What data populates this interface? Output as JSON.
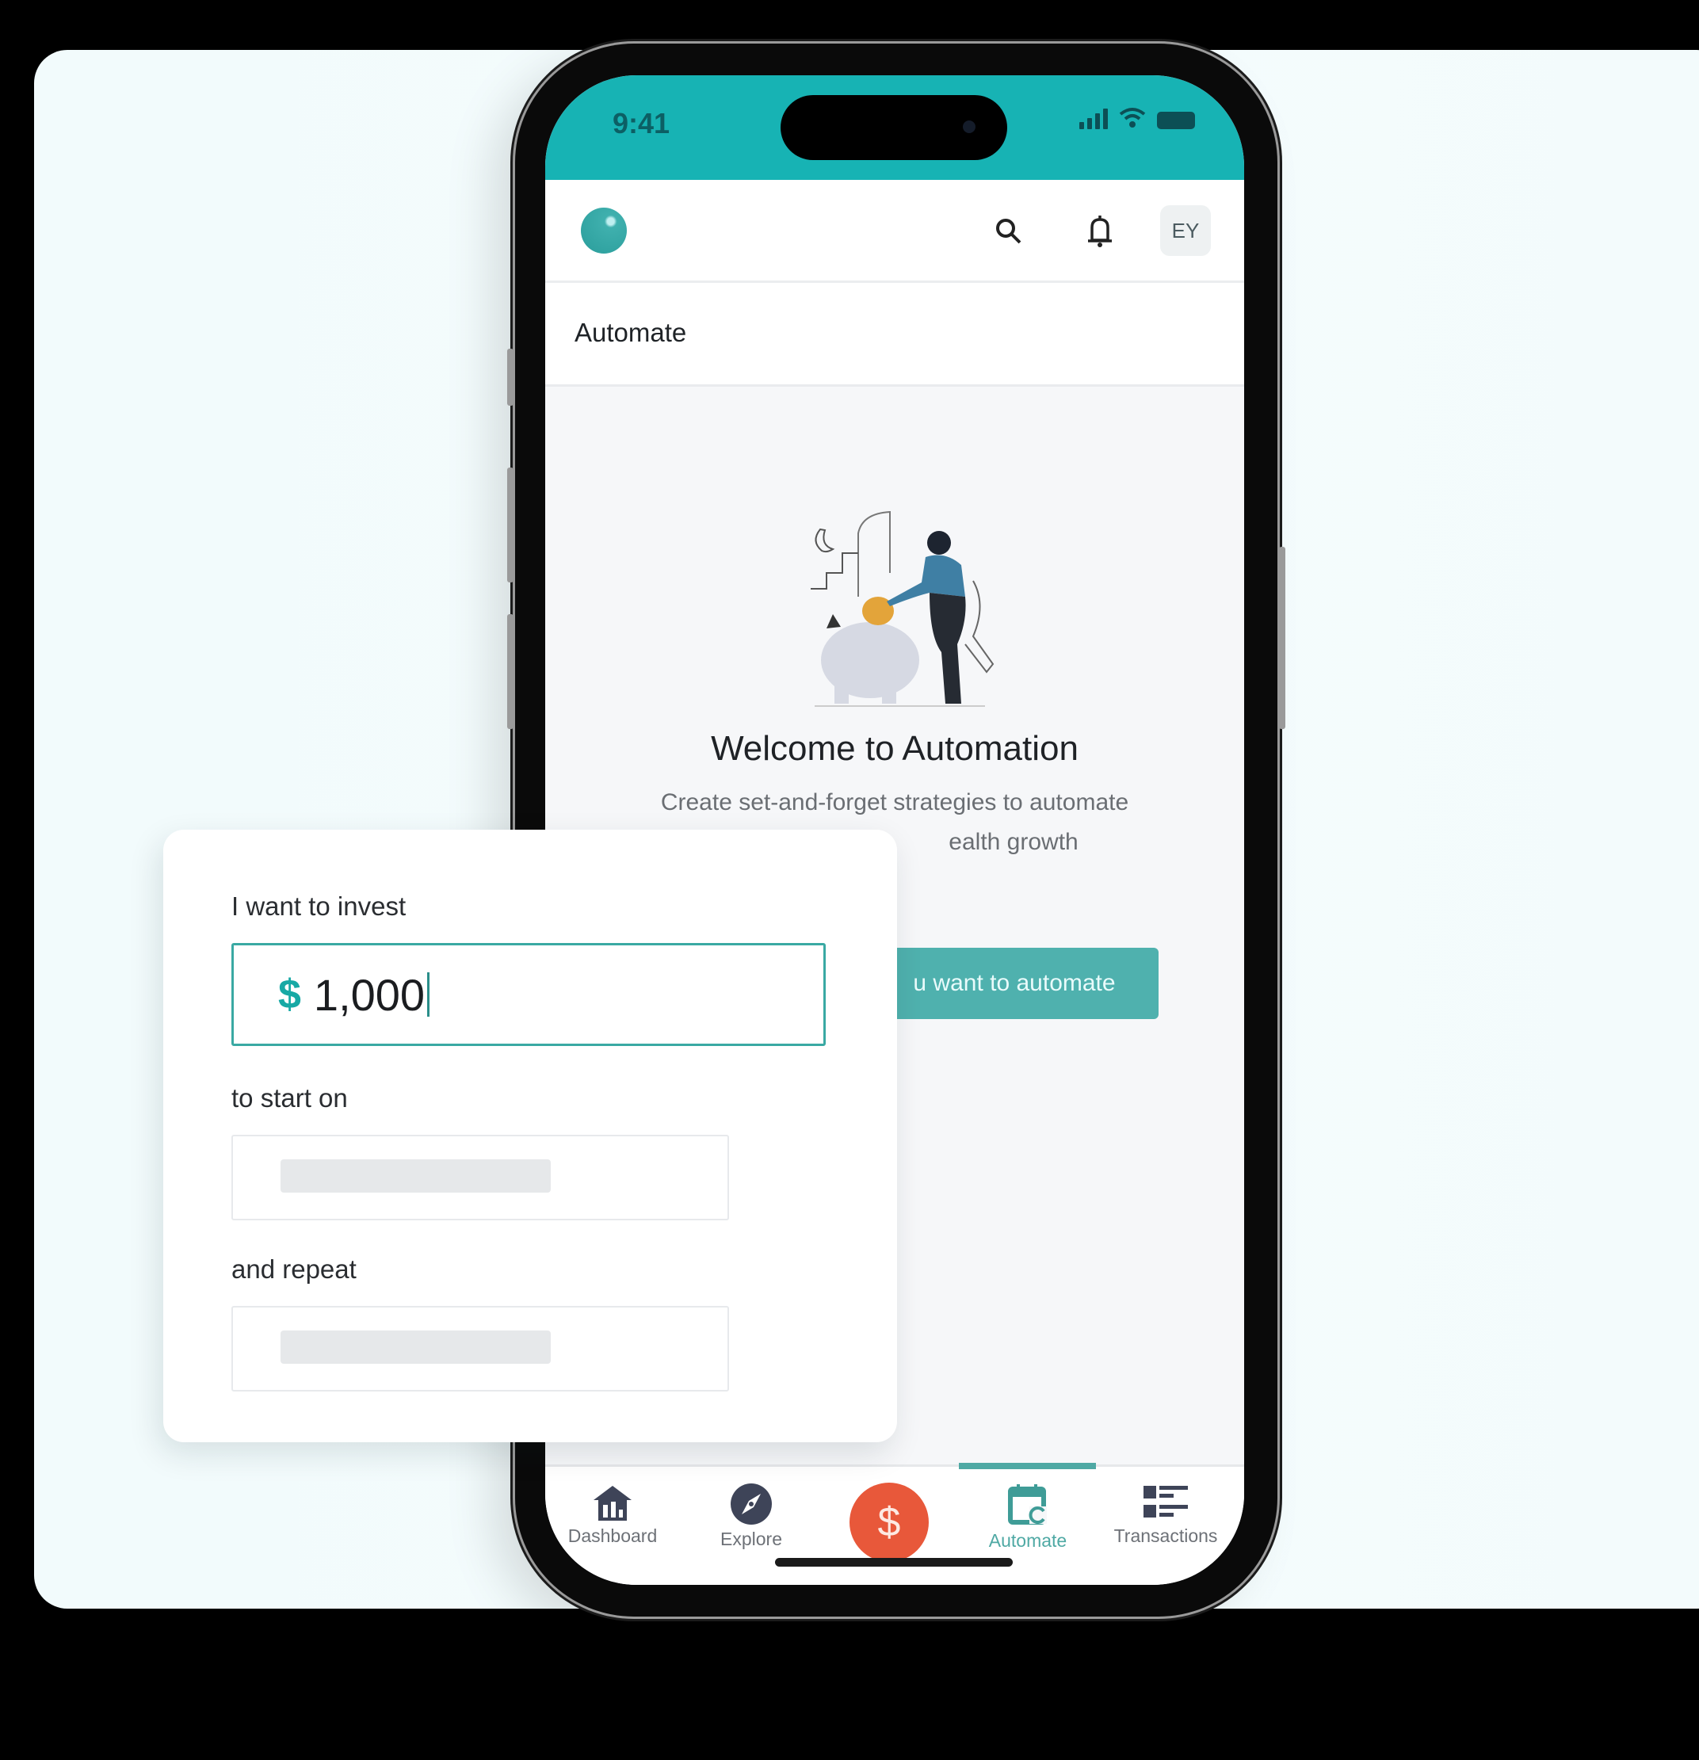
{
  "status_bar": {
    "time": "9:41",
    "icons": [
      "signal-icon",
      "wifi-icon",
      "battery-icon"
    ]
  },
  "header": {
    "logo": "app-logo",
    "search_icon": "search-icon",
    "bell_icon": "bell-icon",
    "avatar_initials": "EY"
  },
  "page": {
    "title": "Automate"
  },
  "welcome": {
    "illustration": "piggy-bank-illustration",
    "title": "Welcome to Automation",
    "subtitle_line1": "Create set-and-forget strategies to automate",
    "subtitle_line2_visible": "ealth growth",
    "cta_visible": "u want to automate"
  },
  "bottom_nav": {
    "items": [
      {
        "label": "Dashboard",
        "icon": "home-chart-icon",
        "active": false
      },
      {
        "label": "Explore",
        "icon": "compass-icon",
        "active": false
      },
      {
        "label": "",
        "icon": "dollar-icon",
        "active": false
      },
      {
        "label": "Automate",
        "icon": "calendar-repeat-icon",
        "active": true
      },
      {
        "label": "Transactions",
        "icon": "list-icon",
        "active": false
      }
    ],
    "fab_symbol": "$"
  },
  "form": {
    "invest_label": "I want to invest",
    "currency_symbol": "$",
    "amount_value": "1,000",
    "start_label": "to start on",
    "repeat_label": "and repeat"
  },
  "colors": {
    "teal": "#17b3b4",
    "accent": "#4fb1ae",
    "fab": "#e8583a"
  }
}
